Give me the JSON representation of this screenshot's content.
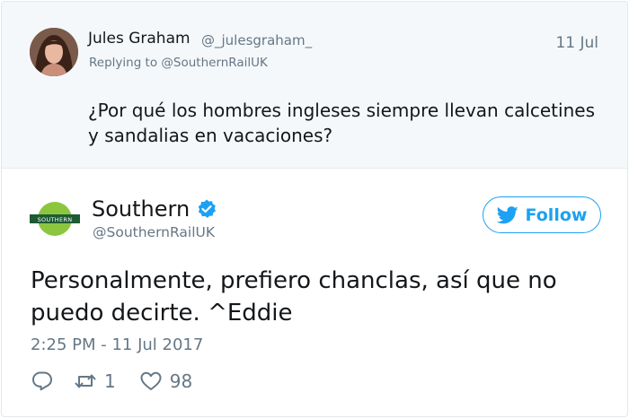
{
  "reply_tweet": {
    "name": "Jules Graham",
    "handle": "@_julesgraham_",
    "date": "11 Jul",
    "replying_to": "Replying to @SouthernRailUK",
    "text": "¿Por qué los hombres ingleses siempre llevan calcetines y sandalias en vacaciones?"
  },
  "main_tweet": {
    "name": "Southern",
    "handle": "@SouthernRailUK",
    "logo_text": "SOUTHERN",
    "follow_label": "Follow",
    "text": "Personalmente, prefiero chanclas, así que no puedo decirte. ^Eddie",
    "timestamp": "2:25 PM - 11 Jul 2017",
    "retweets": "1",
    "likes": "98"
  },
  "colors": {
    "accent": "#1da1f2",
    "muted": "#657786",
    "logo_green": "#8cc63f",
    "logo_dark": "#1e5b33"
  },
  "icons": [
    "reply-icon",
    "retweet-icon",
    "like-icon",
    "verified-icon",
    "twitter-bird-icon"
  ]
}
